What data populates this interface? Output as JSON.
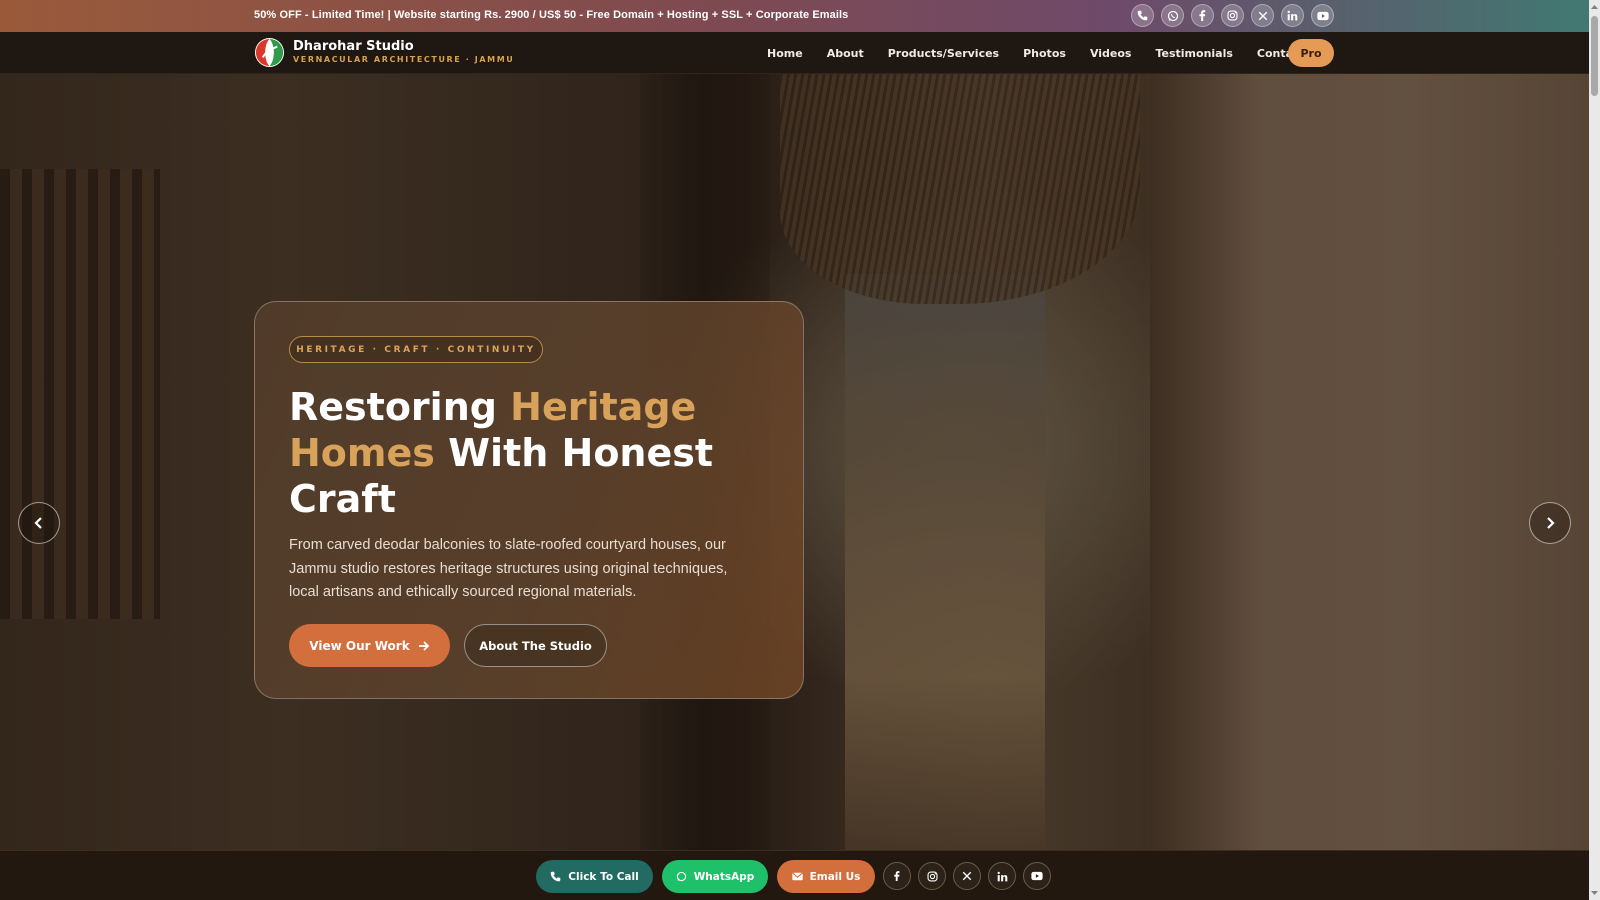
{
  "promo": {
    "text": "50% OFF - Limited Time! | Website starting Rs. 2900 / US$ 50 - Free Domain + Hosting + SSL + Corporate Emails",
    "social_icons": [
      "phone-icon",
      "whatsapp-icon",
      "facebook-icon",
      "instagram-icon",
      "x-icon",
      "linkedin-icon",
      "youtube-icon"
    ]
  },
  "brand": {
    "name": "Dharohar Studio",
    "tagline": "VERNACULAR ARCHITECTURE · JAMMU"
  },
  "nav": {
    "items": [
      "Home",
      "About",
      "Products/Services",
      "Photos",
      "Videos",
      "Testimonials",
      "Contact"
    ],
    "pro_label": "Pro"
  },
  "hero": {
    "badge": "HERITAGE · CRAFT · CONTINUITY",
    "headline_part1": "Restoring ",
    "headline_highlight1": "Heritage Homes",
    "headline_part2": " With Honest Craft",
    "subtext": "From carved deodar balconies to slate-roofed courtyard houses, our Jammu studio restores heritage structures using original techniques, local artisans and ethically sourced regional materials.",
    "primary_button": "View Our Work",
    "secondary_button": "About The Studio"
  },
  "bottom_bar": {
    "call_label": "Click To Call",
    "whatsapp_label": "WhatsApp",
    "email_label": "Email Us",
    "social_icons": [
      "facebook-icon",
      "instagram-icon",
      "x-icon",
      "linkedin-icon",
      "youtube-icon"
    ]
  },
  "colors": {
    "accent": "#d26f3d",
    "highlight": "#d8a25a",
    "whatsapp": "#1ec06a",
    "call": "#226b63"
  }
}
